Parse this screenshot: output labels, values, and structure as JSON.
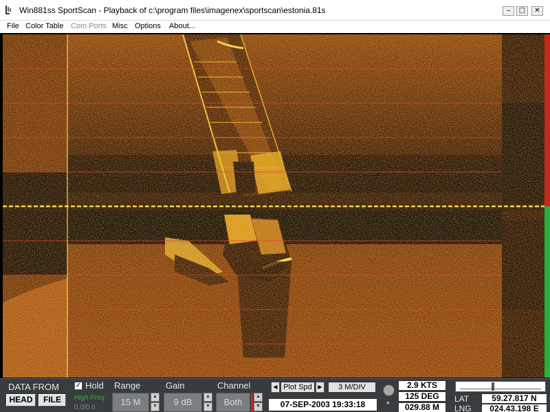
{
  "window": {
    "title": "Win881ss SportScan - Playback of c:\\program files\\imagenex\\sportscan\\estonia.81s",
    "minimize_glyph": "‒",
    "maximize_glyph": "□",
    "close_glyph": "✕"
  },
  "menu": {
    "items": [
      {
        "label": "File",
        "enabled": true
      },
      {
        "label": "Color Table",
        "enabled": true
      },
      {
        "label": "Com Ports",
        "enabled": false
      },
      {
        "label": "Misc",
        "enabled": true
      },
      {
        "label": "Options",
        "enabled": true
      },
      {
        "label": "About...",
        "enabled": true
      }
    ]
  },
  "colors": {
    "sonar_base": "#6a2c05",
    "sonar_highlight": "#ffd23a",
    "scale_red": "#c8271c",
    "scale_green": "#22b43a",
    "panel_bg": "#383c3e"
  },
  "panel": {
    "data_from_label": "DATA FROM",
    "head_button": "HEAD",
    "file_button": "FILE",
    "hold_label": "Hold",
    "hold_checked": true,
    "hold_check_glyph": "✓",
    "high_freq_label": "High Freq",
    "low_readout": "0.0/0.0",
    "range_label": "Range",
    "range_value": "15 M",
    "gain_label": "Gain",
    "gain_value": "9 dB",
    "channel_label": "Channel",
    "channel_value": "Both",
    "spin_up": "▲",
    "spin_down": "▼",
    "arrow_left": "◀",
    "arrow_right": "▶",
    "plot_spd_label": "Plot Spd",
    "scale_value": "3 M/DIV",
    "date_time": "07-SEP-2003  19:33:18",
    "speed": "2.9 KTS",
    "heading": "125 DEG",
    "depth": "029.88 M",
    "lat_label": "LAT",
    "lng_label": "LNG",
    "latitude": "59.27.817 N",
    "longitude": "024.43.198 E",
    "indicator_star": "*"
  }
}
